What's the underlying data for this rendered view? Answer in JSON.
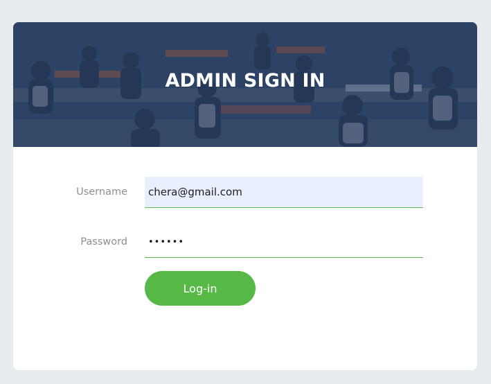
{
  "banner": {
    "title": "ADMIN SIGN IN"
  },
  "form": {
    "username": {
      "label": "Username",
      "value": "chera@gmail.com"
    },
    "password": {
      "label": "Password",
      "value": "••••••"
    },
    "submit_label": "Log-in"
  },
  "colors": {
    "accent": "#57b945",
    "autofill_bg": "#e8f0fe",
    "label": "#8a8f94",
    "page_bg": "#e9ecee",
    "banner_tint": "#203458"
  }
}
